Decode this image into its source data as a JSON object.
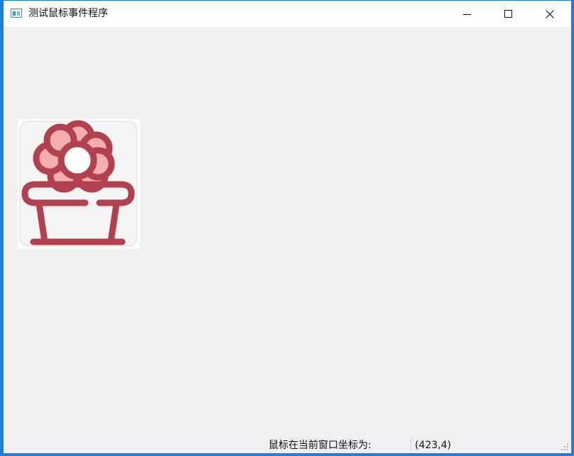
{
  "window": {
    "title": "测试鼠标事件程序",
    "controls": {
      "minimize_icon": "minimize-icon",
      "maximize_icon": "maximize-icon",
      "close_icon": "close-icon"
    }
  },
  "content": {
    "image_icon": "flower-pot-icon",
    "colors": {
      "flower_outline": "#b24150",
      "flower_petal_fill": "#f4aeb0",
      "pot_fill": "#f4f4f4",
      "tile_border": "#dddddd"
    }
  },
  "status_bar": {
    "label": "鼠标在当前窗口坐标为:",
    "value": "(423,4)"
  },
  "colors": {
    "window_border": "#1f7fd6",
    "client_background": "#f0f0f0",
    "titlebar_background": "#ffffff"
  }
}
